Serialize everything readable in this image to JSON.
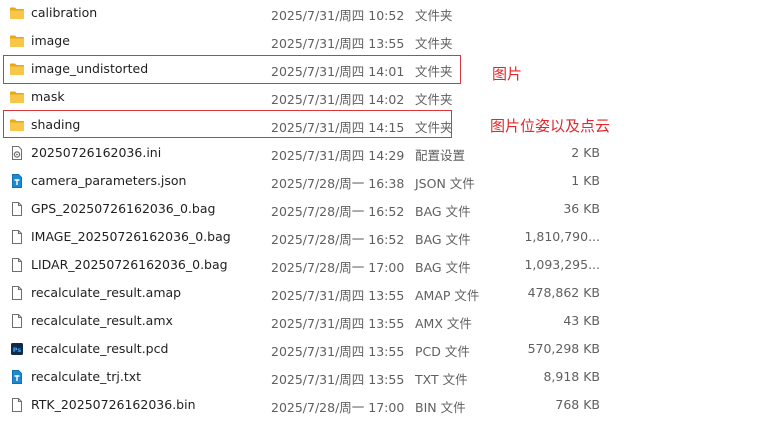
{
  "files": [
    {
      "name": "calibration",
      "date": "2025/7/31/周四 10:52",
      "type": "文件夹",
      "size": "",
      "icon": "folder-icon"
    },
    {
      "name": "image",
      "date": "2025/7/31/周四 13:55",
      "type": "文件夹",
      "size": "",
      "icon": "folder-icon"
    },
    {
      "name": "image_undistorted",
      "date": "2025/7/31/周四 14:01",
      "type": "文件夹",
      "size": "",
      "icon": "folder-icon"
    },
    {
      "name": "mask",
      "date": "2025/7/31/周四 14:02",
      "type": "文件夹",
      "size": "",
      "icon": "folder-icon"
    },
    {
      "name": "shading",
      "date": "2025/7/31/周四 14:15",
      "type": "文件夹",
      "size": "",
      "icon": "folder-icon"
    },
    {
      "name": "20250726162036.ini",
      "date": "2025/7/31/周四 14:29",
      "type": "配置设置",
      "size": "2 KB",
      "icon": "settings-file-icon"
    },
    {
      "name": "camera_parameters.json",
      "date": "2025/7/28/周一 16:38",
      "type": "JSON 文件",
      "size": "1 KB",
      "icon": "text-file-icon"
    },
    {
      "name": "GPS_20250726162036_0.bag",
      "date": "2025/7/28/周一 16:52",
      "type": "BAG 文件",
      "size": "36 KB",
      "icon": "file-icon"
    },
    {
      "name": "IMAGE_20250726162036_0.bag",
      "date": "2025/7/28/周一 16:52",
      "type": "BAG 文件",
      "size": "1,810,790...",
      "icon": "file-icon"
    },
    {
      "name": "LIDAR_20250726162036_0.bag",
      "date": "2025/7/28/周一 17:00",
      "type": "BAG 文件",
      "size": "1,093,295...",
      "icon": "file-icon"
    },
    {
      "name": "recalculate_result.amap",
      "date": "2025/7/31/周四 13:55",
      "type": "AMAP 文件",
      "size": "478,862 KB",
      "icon": "file-icon"
    },
    {
      "name": "recalculate_result.amx",
      "date": "2025/7/31/周四 13:55",
      "type": "AMX 文件",
      "size": "43 KB",
      "icon": "file-icon"
    },
    {
      "name": "recalculate_result.pcd",
      "date": "2025/7/31/周四 13:55",
      "type": "PCD 文件",
      "size": "570,298 KB",
      "icon": "photoshop-file-icon"
    },
    {
      "name": "recalculate_trj.txt",
      "date": "2025/7/31/周四 13:55",
      "type": "TXT 文件",
      "size": "8,918 KB",
      "icon": "text-file-icon"
    },
    {
      "name": "RTK_20250726162036.bin",
      "date": "2025/7/28/周一 17:00",
      "type": "BIN 文件",
      "size": "768 KB",
      "icon": "file-icon"
    }
  ],
  "annotations": {
    "image_undistorted_note": "图片",
    "shading_note": "图片位姿以及点云"
  },
  "colors": {
    "folder": "#f5c342",
    "annotation": "#e5262b",
    "highlight_border": "#d9363e",
    "text_file_accent": "#1a8ad4",
    "photoshop_bg": "#0f2a4a",
    "photoshop_text": "#31a8ff"
  }
}
